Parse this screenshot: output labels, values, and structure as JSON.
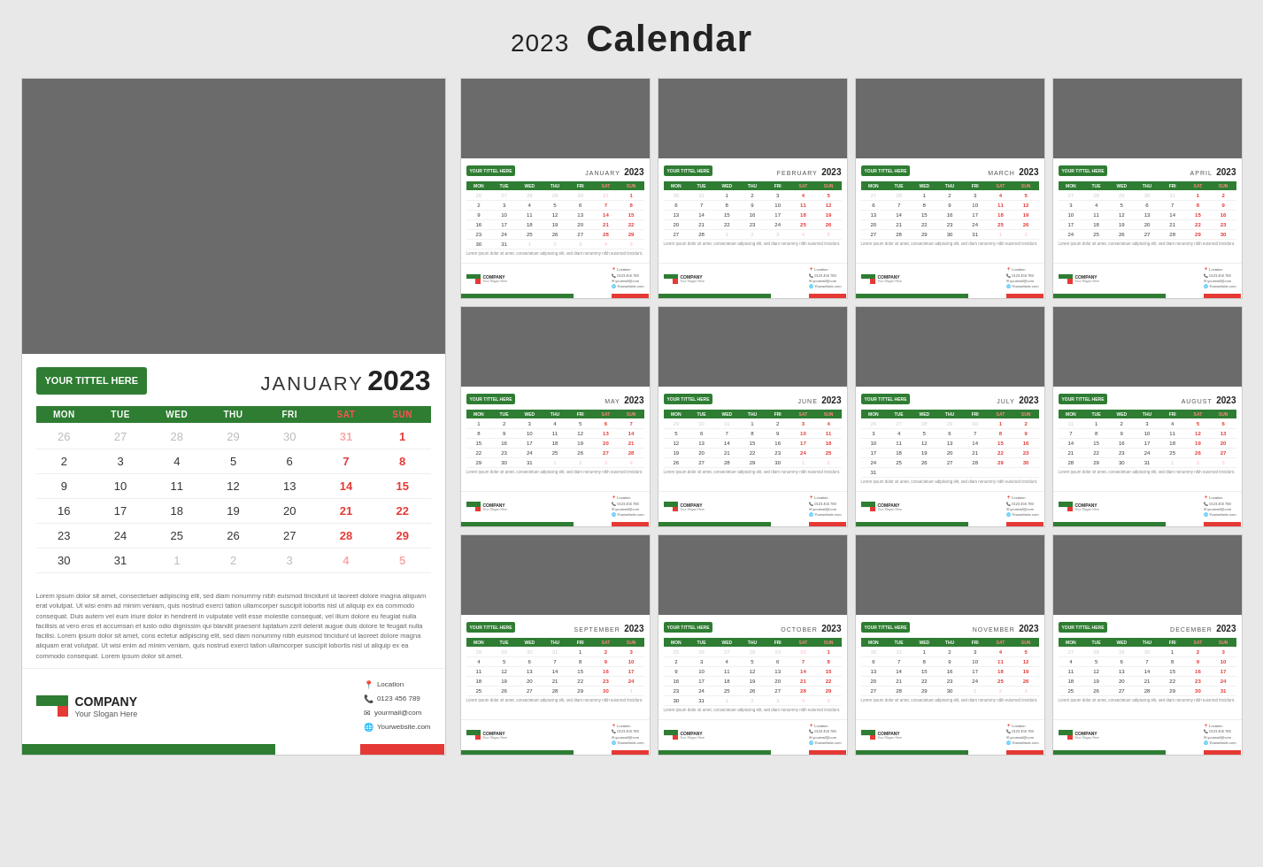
{
  "header": {
    "year": "2023",
    "title": "Calendar"
  },
  "leftPage": {
    "photo_alt": "Photo placeholder",
    "greenBox": "YOUR TITTEL HERE",
    "month": "JANUARY",
    "year": "2023",
    "days_header": [
      "MON",
      "TUE",
      "WED",
      "THU",
      "FRI",
      "SAT",
      "SUN"
    ],
    "weeks": [
      [
        "26",
        "27",
        "28",
        "29",
        "30",
        "31",
        "1"
      ],
      [
        "2",
        "3",
        "4",
        "5",
        "6",
        "7",
        "8"
      ],
      [
        "9",
        "10",
        "11",
        "12",
        "13",
        "14",
        "15"
      ],
      [
        "16",
        "17",
        "18",
        "19",
        "20",
        "21",
        "22"
      ],
      [
        "23",
        "24",
        "25",
        "26",
        "27",
        "28",
        "29"
      ],
      [
        "30",
        "31",
        "1",
        "2",
        "3",
        "4",
        "5"
      ]
    ],
    "lorem1": "Lorem ipsum dolor sit amet, consectetuer adipiscing elit, sed diam nonummy nibh euismod tincidunt ut laoreet dolore magna aliquam erat volutpat. Ut wisi enim ad minim veniam, quis nostrud exerci tation ullamcorper suscipit lobortis nisl ut aliquip ex ea commodo consequat. Duis autem vel eum iriure dolor in hendrerit in vulputate velit esse molestie consequat, vel illum dolore eu feugiat nulla facilisis at vero eros et accumsan et iusto odio dignissim qui blandit praesent luptatum zzril delenit augue duis dolore te feugait nulla facilisi. Lorem ipsum dolor sit amet, cons ectetur adipiscing elit, sed diam nonummy nibh euismod tincidunt ut laoreet dolore magna aliquam erat volutpat. Ut wisi enim ad minim veniam, quis nostrud exerci tation ullamcorper suscipit lobortis nisl ut aliquip ex ea commodo consequat. Lorem ipsum dolor sit amet.",
    "company": "COMPANY",
    "slogan": "Your Slogan Here",
    "contact": {
      "location": "Location",
      "phone": "0123 456 789",
      "email": "yourmail@com",
      "website": "Yourwebsite.com"
    }
  },
  "months": [
    {
      "name": "JANUARY",
      "year": "2023",
      "greenBox": "YOUR TITTEL HERE",
      "weeks": [
        [
          "26",
          "27",
          "28",
          "29",
          "30",
          "31",
          "1"
        ],
        [
          "2",
          "3",
          "4",
          "5",
          "6",
          "7",
          "8"
        ],
        [
          "9",
          "10",
          "11",
          "12",
          "13",
          "14",
          "15"
        ],
        [
          "16",
          "17",
          "18",
          "19",
          "20",
          "21",
          "22"
        ],
        [
          "23",
          "24",
          "25",
          "26",
          "27",
          "28",
          "29"
        ],
        [
          "30",
          "31",
          "1",
          "2",
          "3",
          "4",
          "5"
        ]
      ]
    },
    {
      "name": "FEBRUARY",
      "year": "2023",
      "greenBox": "YOUR TITTEL HERE",
      "weeks": [
        [
          "30",
          "31",
          "1",
          "2",
          "3",
          "4",
          "5"
        ],
        [
          "6",
          "7",
          "8",
          "9",
          "10",
          "11",
          "12"
        ],
        [
          "13",
          "14",
          "15",
          "16",
          "17",
          "18",
          "19"
        ],
        [
          "20",
          "21",
          "22",
          "23",
          "24",
          "25",
          "26"
        ],
        [
          "27",
          "28",
          "1",
          "2",
          "3",
          "4",
          "5"
        ],
        [
          "",
          "",
          "",
          "",
          "",
          "",
          ""
        ]
      ]
    },
    {
      "name": "MARCH",
      "year": "2023",
      "greenBox": "YOUR TITTEL HERE",
      "weeks": [
        [
          "27",
          "28",
          "1",
          "2",
          "3",
          "4",
          "5"
        ],
        [
          "6",
          "7",
          "8",
          "9",
          "10",
          "11",
          "12"
        ],
        [
          "13",
          "14",
          "15",
          "16",
          "17",
          "18",
          "19"
        ],
        [
          "20",
          "21",
          "22",
          "23",
          "24",
          "25",
          "26"
        ],
        [
          "27",
          "28",
          "29",
          "30",
          "31",
          "1",
          "2"
        ],
        [
          "",
          "",
          "",
          "",
          "",
          "",
          ""
        ]
      ]
    },
    {
      "name": "APRIL",
      "year": "2023",
      "greenBox": "YOUR TITTEL HERE",
      "weeks": [
        [
          "27",
          "28",
          "29",
          "30",
          "31",
          "1",
          "2"
        ],
        [
          "3",
          "4",
          "5",
          "6",
          "7",
          "8",
          "9"
        ],
        [
          "10",
          "11",
          "12",
          "13",
          "14",
          "15",
          "16"
        ],
        [
          "17",
          "18",
          "19",
          "20",
          "21",
          "22",
          "23"
        ],
        [
          "24",
          "25",
          "26",
          "27",
          "28",
          "29",
          "30"
        ],
        [
          "",
          "",
          "",
          "",
          "",
          "",
          ""
        ]
      ]
    },
    {
      "name": "MAY",
      "year": "2023",
      "greenBox": "YOUR TITTEL HERE",
      "weeks": [
        [
          "1",
          "2",
          "3",
          "4",
          "5",
          "6",
          "7"
        ],
        [
          "8",
          "9",
          "10",
          "11",
          "12",
          "13",
          "14"
        ],
        [
          "15",
          "16",
          "17",
          "18",
          "19",
          "20",
          "21"
        ],
        [
          "22",
          "23",
          "24",
          "25",
          "26",
          "27",
          "28"
        ],
        [
          "29",
          "30",
          "31",
          "1",
          "2",
          "3",
          "4"
        ],
        [
          "",
          "",
          "",
          "",
          "",
          "",
          ""
        ]
      ]
    },
    {
      "name": "JUNE",
      "year": "2023",
      "greenBox": "YOUR TITTEL HERE",
      "weeks": [
        [
          "29",
          "30",
          "31",
          "1",
          "2",
          "3",
          "4"
        ],
        [
          "5",
          "6",
          "7",
          "8",
          "9",
          "10",
          "11"
        ],
        [
          "12",
          "13",
          "14",
          "15",
          "16",
          "17",
          "18"
        ],
        [
          "19",
          "20",
          "21",
          "22",
          "23",
          "24",
          "25"
        ],
        [
          "26",
          "27",
          "28",
          "29",
          "30",
          "1",
          "2"
        ],
        [
          "",
          "",
          "",
          "",
          "",
          "",
          ""
        ]
      ]
    },
    {
      "name": "JULY",
      "year": "2023",
      "greenBox": "YOUR TITTEL HERE",
      "weeks": [
        [
          "26",
          "27",
          "28",
          "29",
          "30",
          "1",
          "2"
        ],
        [
          "3",
          "4",
          "5",
          "6",
          "7",
          "8",
          "9"
        ],
        [
          "10",
          "11",
          "12",
          "13",
          "14",
          "15",
          "16"
        ],
        [
          "17",
          "18",
          "19",
          "20",
          "21",
          "22",
          "23"
        ],
        [
          "24",
          "25",
          "26",
          "27",
          "28",
          "29",
          "30"
        ],
        [
          "31",
          "",
          "",
          "",
          "",
          "",
          ""
        ]
      ]
    },
    {
      "name": "AUGUST",
      "year": "2023",
      "greenBox": "YOUR TITTEL HERE",
      "weeks": [
        [
          "31",
          "1",
          "2",
          "3",
          "4",
          "5",
          "6"
        ],
        [
          "7",
          "8",
          "9",
          "10",
          "11",
          "12",
          "13"
        ],
        [
          "14",
          "15",
          "16",
          "17",
          "18",
          "19",
          "20"
        ],
        [
          "21",
          "22",
          "23",
          "24",
          "25",
          "26",
          "27"
        ],
        [
          "28",
          "29",
          "30",
          "31",
          "1",
          "2",
          "3"
        ],
        [
          "",
          "",
          "",
          "",
          "",
          "",
          ""
        ]
      ]
    },
    {
      "name": "SEPTEMBER",
      "year": "2023",
      "greenBox": "YOUR TITTEL HERE",
      "weeks": [
        [
          "28",
          "29",
          "30",
          "31",
          "1",
          "2",
          "3"
        ],
        [
          "4",
          "5",
          "6",
          "7",
          "8",
          "9",
          "10"
        ],
        [
          "11",
          "12",
          "13",
          "14",
          "15",
          "16",
          "17"
        ],
        [
          "18",
          "19",
          "20",
          "21",
          "22",
          "23",
          "24"
        ],
        [
          "25",
          "26",
          "27",
          "28",
          "29",
          "30",
          "1"
        ],
        [
          "",
          "",
          "",
          "",
          "",
          "",
          ""
        ]
      ]
    },
    {
      "name": "OCTOBER",
      "year": "2023",
      "greenBox": "YOUR TITTEL HERE",
      "weeks": [
        [
          "25",
          "26",
          "27",
          "28",
          "29",
          "30",
          "1"
        ],
        [
          "2",
          "3",
          "4",
          "5",
          "6",
          "7",
          "8"
        ],
        [
          "9",
          "10",
          "11",
          "12",
          "13",
          "14",
          "15"
        ],
        [
          "16",
          "17",
          "18",
          "19",
          "20",
          "21",
          "22"
        ],
        [
          "23",
          "24",
          "25",
          "26",
          "27",
          "28",
          "29"
        ],
        [
          "30",
          "31",
          "1",
          "2",
          "3",
          "4",
          "5"
        ]
      ]
    },
    {
      "name": "NOVEMBER",
      "year": "2023",
      "greenBox": "YOUR TITTEL HERE",
      "weeks": [
        [
          "30",
          "31",
          "1",
          "2",
          "3",
          "4",
          "5"
        ],
        [
          "6",
          "7",
          "8",
          "9",
          "10",
          "11",
          "12"
        ],
        [
          "13",
          "14",
          "15",
          "16",
          "17",
          "18",
          "19"
        ],
        [
          "20",
          "21",
          "22",
          "23",
          "24",
          "25",
          "26"
        ],
        [
          "27",
          "28",
          "29",
          "30",
          "1",
          "2",
          "3"
        ],
        [
          "",
          "",
          "",
          "",
          "",
          "",
          ""
        ]
      ]
    },
    {
      "name": "DECEMBER",
      "year": "2023",
      "greenBox": "YOUR TITTEL HERE",
      "weeks": [
        [
          "27",
          "28",
          "29",
          "30",
          "1",
          "2",
          "3"
        ],
        [
          "4",
          "5",
          "6",
          "7",
          "8",
          "9",
          "10"
        ],
        [
          "11",
          "12",
          "13",
          "14",
          "15",
          "16",
          "17"
        ],
        [
          "18",
          "19",
          "20",
          "21",
          "22",
          "23",
          "24"
        ],
        [
          "25",
          "26",
          "27",
          "28",
          "29",
          "30",
          "31"
        ],
        [
          "",
          "",
          "",
          "",
          "",
          "",
          ""
        ]
      ]
    }
  ],
  "days_header": [
    "MON",
    "TUE",
    "WED",
    "THU",
    "FRI",
    "SAT",
    "SUN"
  ],
  "company": "COMPANY",
  "slogan": "Your Slogan Here",
  "contact_lines": [
    "Location",
    "0123 456 789",
    "yourmail@com",
    "Yourwebsite.com"
  ]
}
